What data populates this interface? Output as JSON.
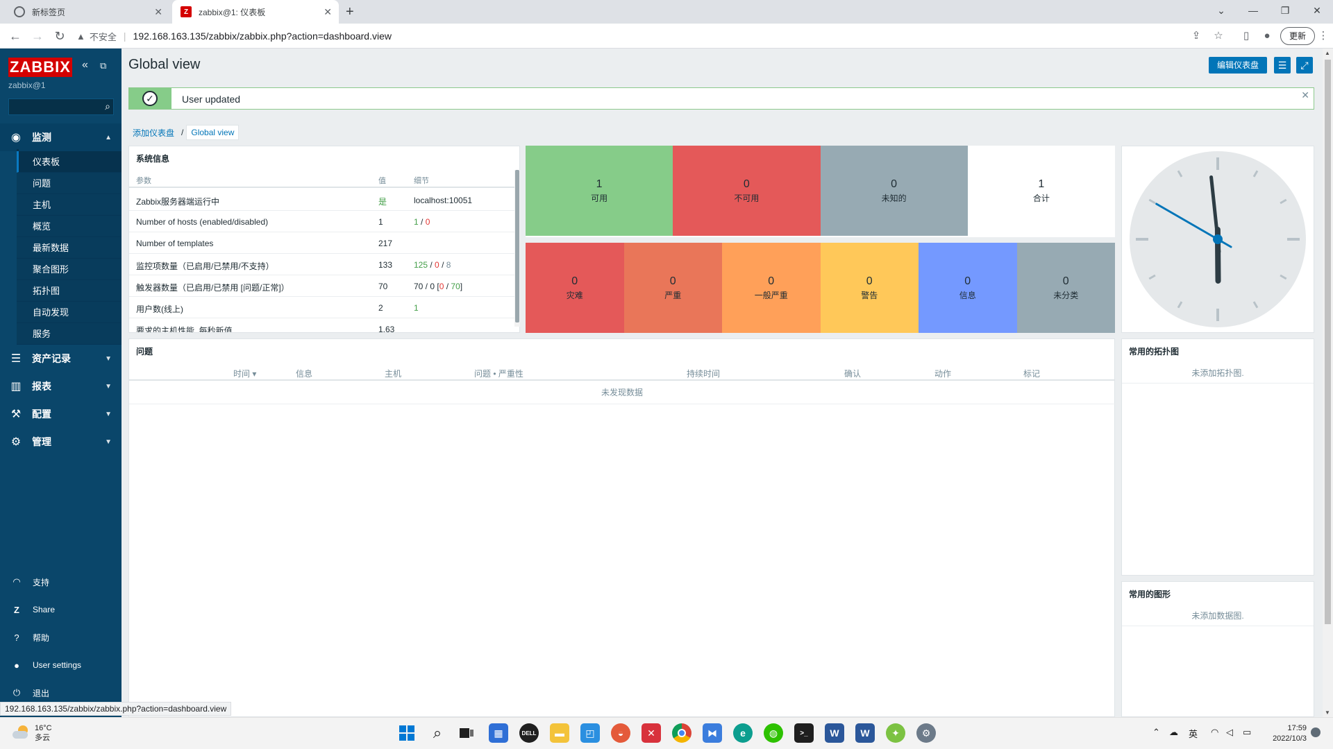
{
  "browser": {
    "tabs": [
      {
        "title": "新标签页"
      },
      {
        "title": "zabbix@1: 仪表板"
      }
    ],
    "security_label": "不安全",
    "url": "192.168.163.135/zabbix/zabbix.php?action=dashboard.view",
    "update_label": "更新",
    "status_url": "192.168.163.135/zabbix/zabbix.php?action=dashboard.view"
  },
  "sidebar": {
    "logo": "ZABBIX",
    "user": "zabbix@1",
    "search_placeholder": "",
    "sections": [
      {
        "label": "监测",
        "icon": "eye-icon"
      },
      {
        "label": "资产记录",
        "icon": "list-icon"
      },
      {
        "label": "报表",
        "icon": "bar-chart-icon"
      },
      {
        "label": "配置",
        "icon": "wrench-icon"
      },
      {
        "label": "管理",
        "icon": "gear-icon"
      }
    ],
    "monitoring_items": [
      "仪表板",
      "问题",
      "主机",
      "概览",
      "最新数据",
      "聚合图形",
      "拓扑图",
      "自动发现",
      "服务"
    ],
    "bottom": [
      {
        "label": "支持",
        "icon": "headset-icon"
      },
      {
        "label": "Share",
        "icon": "share-icon"
      },
      {
        "label": "帮助",
        "icon": "help-icon"
      },
      {
        "label": "User settings",
        "icon": "user-icon"
      },
      {
        "label": "退出",
        "icon": "power-icon"
      }
    ]
  },
  "page": {
    "title": "Global view",
    "edit_button": "编辑仪表盘",
    "message": "User updated",
    "breadcrumbs": [
      "添加仪表盘",
      "Global view"
    ]
  },
  "system_info": {
    "title": "系统信息",
    "headers": [
      "参数",
      "值",
      "细节"
    ],
    "rows": [
      {
        "param": "Zabbix服务器端运行中",
        "value": "是",
        "d1": "localhost:10051",
        "d2": "",
        "d3": "",
        "d4": "",
        "d5": ""
      },
      {
        "param": "Number of hosts (enabled/disabled)",
        "value": "1",
        "d1": "1",
        "d2": " / ",
        "d3": "0",
        "d4": "",
        "d5": ""
      },
      {
        "param": "Number of templates",
        "value": "217",
        "d1": "",
        "d2": "",
        "d3": "",
        "d4": "",
        "d5": ""
      },
      {
        "param": "监控项数量（已启用/已禁用/不支持）",
        "value": "133",
        "d1": "125",
        "d2": " / ",
        "d3": "0",
        "d4": " / ",
        "d5": "8"
      },
      {
        "param": "触发器数量（已启用/已禁用 [问题/正常]）",
        "value": "70",
        "d1": "70 / 0 [",
        "d2": "0",
        "d3": " / ",
        "d4": "70",
        "d5": "]"
      },
      {
        "param": "用户数(线上)",
        "value": "2",
        "d1": "1",
        "d2": "",
        "d3": "",
        "d4": "",
        "d5": ""
      },
      {
        "param": "要求的主机性能, 每秒新值",
        "value": "1.63",
        "d1": "",
        "d2": "",
        "d3": "",
        "d4": "",
        "d5": ""
      }
    ]
  },
  "host_availability": [
    {
      "count": "1",
      "label": "可用",
      "color": "#86cc89"
    },
    {
      "count": "0",
      "label": "不可用",
      "color": "#e45959"
    },
    {
      "count": "0",
      "label": "未知的",
      "color": "#97aab3"
    },
    {
      "count": "1",
      "label": "合计",
      "color": "#ffffff"
    }
  ],
  "severity": [
    {
      "count": "0",
      "label": "灾难",
      "color": "#e45959"
    },
    {
      "count": "0",
      "label": "严重",
      "color": "#e97659"
    },
    {
      "count": "0",
      "label": "一般严重",
      "color": "#ffa059"
    },
    {
      "count": "0",
      "label": "警告",
      "color": "#ffc859"
    },
    {
      "count": "0",
      "label": "信息",
      "color": "#7499ff"
    },
    {
      "count": "0",
      "label": "未分类",
      "color": "#97aab3"
    }
  ],
  "problems": {
    "title": "问题",
    "headers": [
      "时间 ▾",
      "信息",
      "主机",
      "问题 • 严重性",
      "持续时间",
      "确认",
      "动作",
      "标记"
    ],
    "empty": "未发现数据"
  },
  "favorite_maps": {
    "title": "常用的拓扑图",
    "empty": "未添加拓扑图."
  },
  "favorite_graphs": {
    "title": "常用的图形",
    "empty": "未添加数据图."
  },
  "clock": {
    "hour": 5,
    "minute": 59
  },
  "taskbar": {
    "temperature": "16°C",
    "weather": "多云",
    "ime": "英",
    "time": "17:59",
    "date": "2022/10/3"
  }
}
